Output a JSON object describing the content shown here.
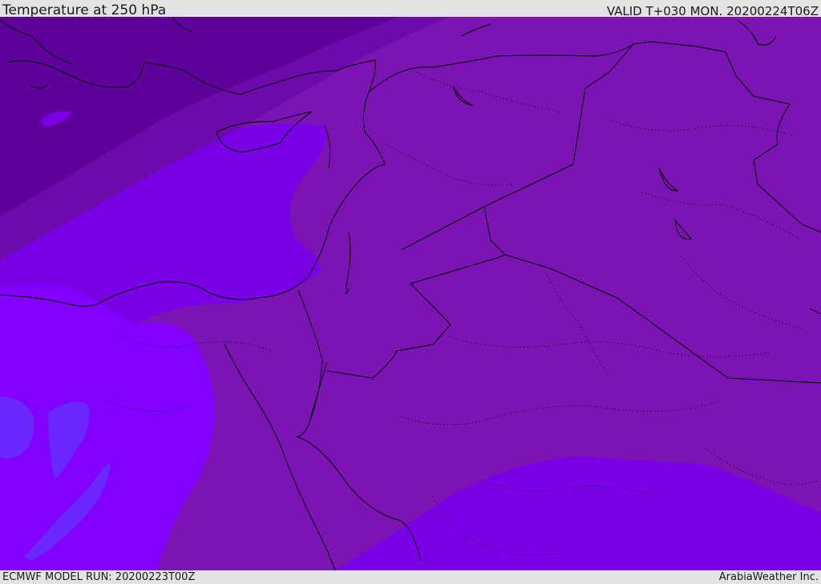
{
  "header": {
    "title": "Temperature at 250 hPa",
    "valid": "VALID T+030 MON. 20200224T06Z"
  },
  "footer": {
    "model_run": "ECMWF MODEL RUN: 20200223T00Z",
    "credit": "ArabiaWeather Inc."
  },
  "map": {
    "field": "temperature",
    "level": "250 hPa",
    "colors": {
      "band_darkest": "#5e009a",
      "band_dark": "#6d0aac",
      "band_mid": "#7b14b2",
      "band_violet": "#7a00e6",
      "band_bright": "#8200ff",
      "band_blue_violet": "#6a28ff",
      "coastline": "#000000"
    }
  }
}
